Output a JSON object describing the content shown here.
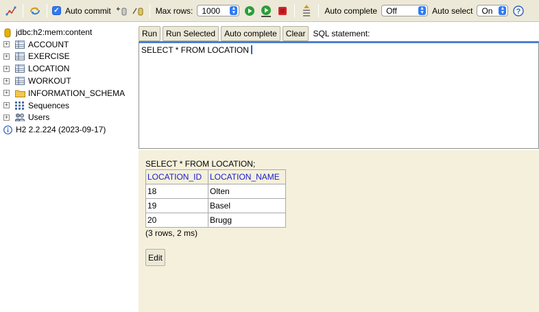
{
  "toolbar": {
    "auto_commit_label": "Auto commit",
    "max_rows_label": "Max rows:",
    "max_rows_value": "1000",
    "auto_complete_label": "Auto complete",
    "auto_complete_value": "Off",
    "auto_select_label": "Auto select",
    "auto_select_value": "On",
    "help_glyph": "?"
  },
  "tree": {
    "connection": "jdbc:h2:mem:content",
    "items": [
      {
        "label": "ACCOUNT",
        "icon": "table-icon"
      },
      {
        "label": "EXERCISE",
        "icon": "table-icon"
      },
      {
        "label": "LOCATION",
        "icon": "table-icon"
      },
      {
        "label": "WORKOUT",
        "icon": "table-icon"
      },
      {
        "label": "INFORMATION_SCHEMA",
        "icon": "folder-icon"
      },
      {
        "label": "Sequences",
        "icon": "sequences-icon"
      },
      {
        "label": "Users",
        "icon": "users-icon"
      }
    ],
    "version": "H2 2.2.224 (2023-09-17)"
  },
  "query": {
    "run_label": "Run",
    "run_selected_label": "Run Selected",
    "auto_complete_label": "Auto complete",
    "clear_label": "Clear",
    "sql_statement_label": "SQL statement:",
    "sql_text": "SELECT * FROM LOCATION"
  },
  "result": {
    "sql": "SELECT * FROM LOCATION;",
    "columns": [
      "LOCATION_ID",
      "LOCATION_NAME"
    ],
    "rows": [
      [
        "18",
        "Olten"
      ],
      [
        "19",
        "Basel"
      ],
      [
        "20",
        "Brugg"
      ]
    ],
    "row_count": "(3 rows, 2 ms)",
    "edit_label": "Edit"
  },
  "colors": {
    "toolbar_bg": "#ece9d8",
    "result_bg": "#f4f0dc",
    "header_link": "#1a1acb",
    "accent": "#2f7af5"
  }
}
